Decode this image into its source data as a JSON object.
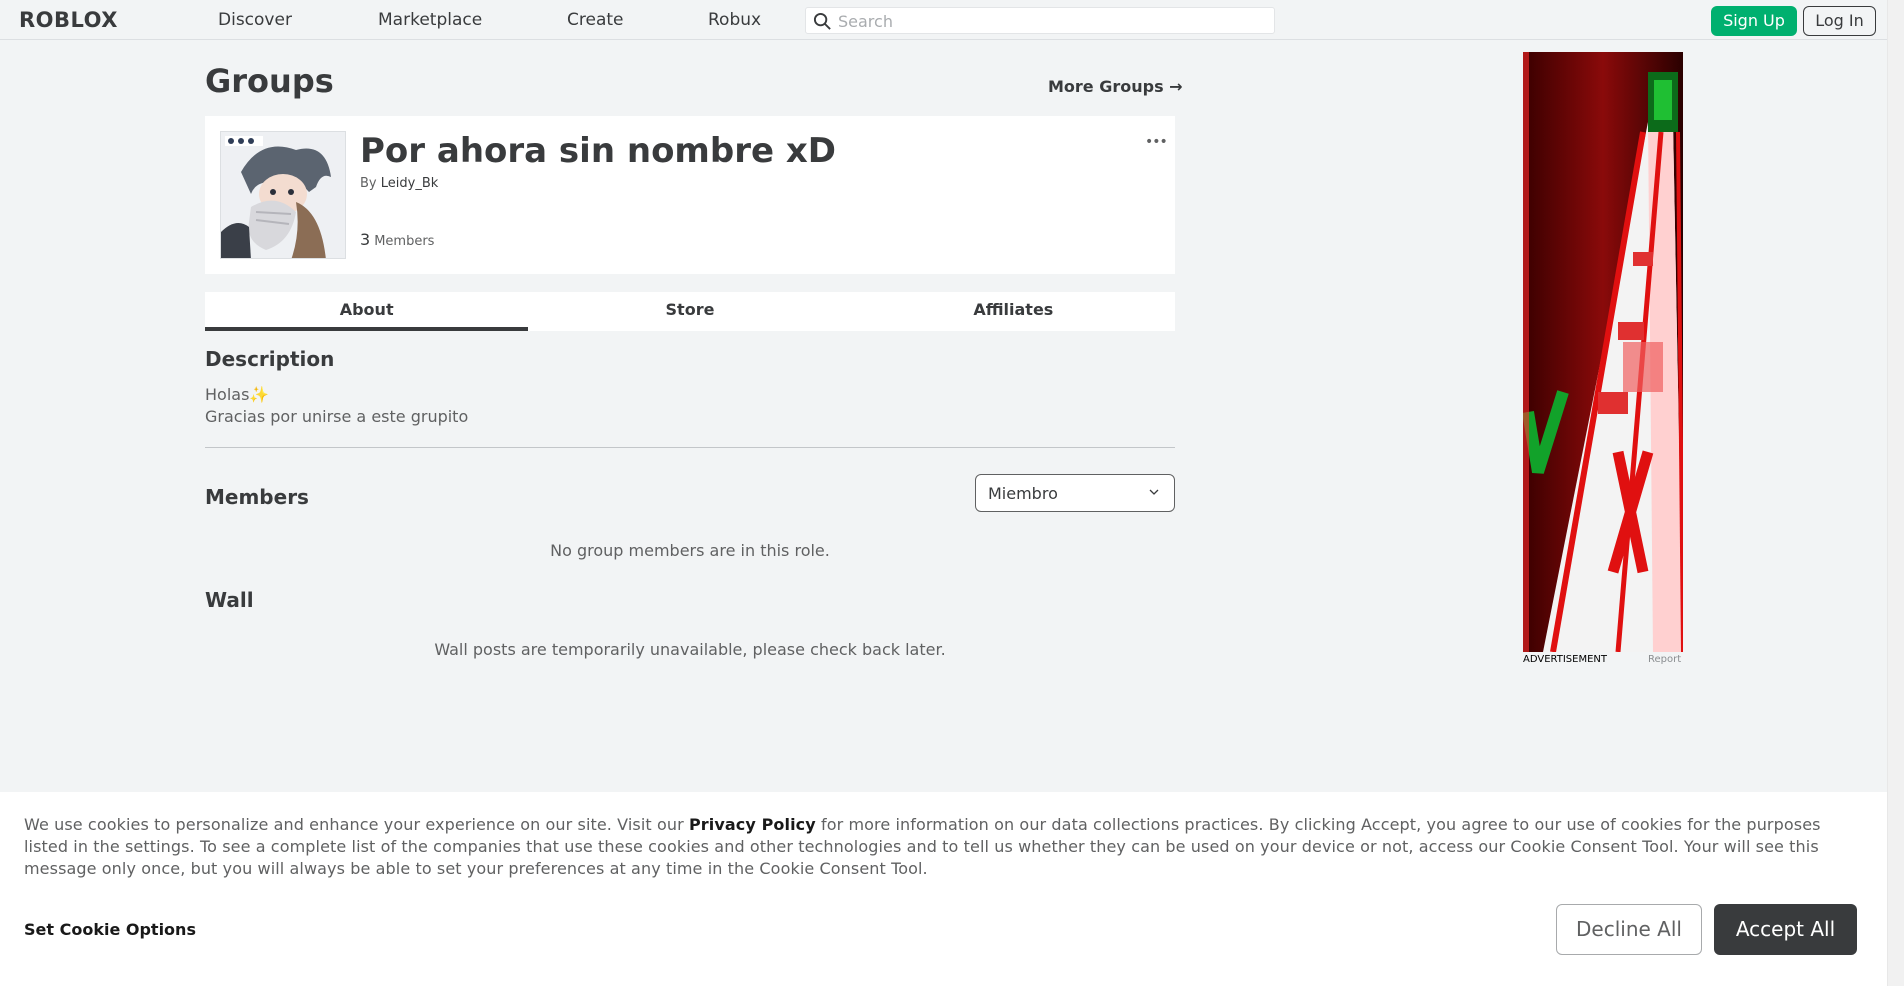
{
  "topbar": {
    "logo": "ROBLOX",
    "nav": [
      "Discover",
      "Marketplace",
      "Create",
      "Robux"
    ],
    "search_placeholder": "Search",
    "signup_label": "Sign Up",
    "login_label": "Log In"
  },
  "page": {
    "title": "Groups",
    "more_groups": "More Groups →"
  },
  "group": {
    "name": "Por ahora sin nombre xD",
    "by_label": "By",
    "owner": "Leidy_Bk",
    "member_count": "3",
    "members_label": "Members",
    "more_menu": "•••"
  },
  "tabs": [
    {
      "label": "About",
      "active": true
    },
    {
      "label": "Store",
      "active": false
    },
    {
      "label": "Affiliates",
      "active": false
    }
  ],
  "about": {
    "description_title": "Description",
    "description_line1": "Holas✨",
    "description_line2": "Gracias por unirse a este grupito",
    "members_title": "Members",
    "role_selected": "Miembro",
    "no_members_msg": "No group members are in this role.",
    "wall_title": "Wall",
    "wall_msg": "Wall posts are temporarily unavailable, please check back later."
  },
  "ad": {
    "label": "ADVERTISEMENT",
    "report": "Report"
  },
  "cookie": {
    "text_part1": "We use cookies to personalize and enhance your experience on our site. Visit our ",
    "privacy_link": "Privacy Policy",
    "text_part2": " for more information on our data collections practices. By clicking Accept, you agree to our use of cookies for the purposes listed in the settings. To see a complete list of the companies that use these cookies and other technologies and to tell us whether they can be used on your device or not, access our Cookie Consent Tool. Your will see this message only once, but you will always be able to set your preferences at any time in the Cookie Consent Tool.",
    "set_options": "Set Cookie Options",
    "decline": "Decline All",
    "accept": "Accept All"
  },
  "colors": {
    "accent_green": "#00b06f",
    "text_primary": "#393b3d",
    "background": "#f2f4f5"
  }
}
